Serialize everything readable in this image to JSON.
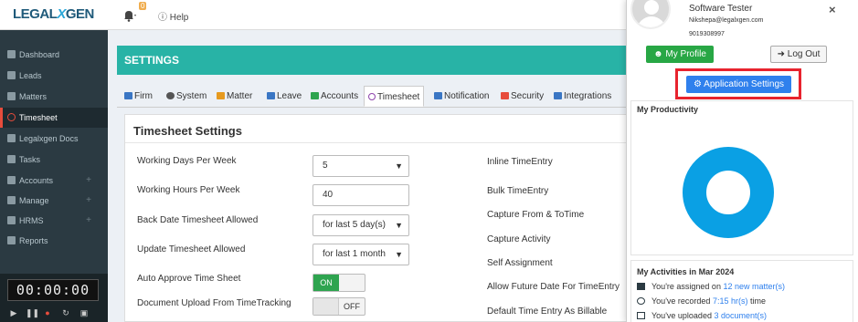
{
  "header": {
    "logo_main": "LEGAL",
    "logo_x": "X",
    "logo_end": "GEN",
    "notifications_count": "0",
    "help_label": "Help"
  },
  "sidebar": {
    "items": [
      {
        "label": "Dashboard",
        "icon": "dashboard-icon"
      },
      {
        "label": "Leads",
        "icon": "phone-icon"
      },
      {
        "label": "Matters",
        "icon": "briefcase-icon"
      },
      {
        "label": "Timesheet",
        "icon": "clock-icon"
      },
      {
        "label": "Legalxgen Docs",
        "icon": "folder-icon"
      },
      {
        "label": "Tasks",
        "icon": "tasks-icon"
      },
      {
        "label": "Accounts",
        "icon": "accounts-icon"
      },
      {
        "label": "Manage",
        "icon": "manage-icon"
      },
      {
        "label": "HRMS",
        "icon": "hrms-icon"
      },
      {
        "label": "Reports",
        "icon": "reports-icon"
      }
    ],
    "plus": "+",
    "timer": "00:00:00"
  },
  "settings": {
    "title": "SETTINGS",
    "tabs": [
      "Firm",
      "System",
      "Matter",
      "Leave",
      "Accounts",
      "Timesheet",
      "Notification",
      "Security",
      "Integrations"
    ],
    "active_tab": "Timesheet",
    "panel_title": "Timesheet Settings",
    "left_fields": [
      {
        "label": "Working Days Per Week",
        "value": "5"
      },
      {
        "label": "Working Hours Per Week",
        "value": "40"
      },
      {
        "label": "Back Date Timesheet Allowed",
        "value": "for last 5 day(s)"
      },
      {
        "label": "Update Timesheet Allowed",
        "value": "for last 1 month"
      },
      {
        "label": "Auto Approve Time Sheet",
        "value": "ON"
      },
      {
        "label": "Document Upload From TimeTracking",
        "value": "OFF"
      }
    ],
    "right_labels": [
      "Inline TimeEntry",
      "Bulk TimeEntry",
      "Capture From & ToTime",
      "Capture Activity",
      "Self Assignment",
      "Allow Future Date For TimeEntry",
      "Default Time Entry As Billable"
    ]
  },
  "profile": {
    "role": "Software Tester",
    "email": "Nikshepa@legalxgen.com",
    "phone": "9019308997",
    "close": "×",
    "my_profile_label": "My Profile",
    "logout_label": "Log Out",
    "app_settings_label": "Application Settings",
    "productivity_title": "My Productivity",
    "activities_title": "My Activities in Mar 2024",
    "activities": [
      {
        "prefix": "You're assigned on ",
        "link": "12 new matter(s)",
        "suffix": ""
      },
      {
        "prefix": "You've recorded ",
        "link": "7:15 hr(s)",
        "suffix": " time"
      },
      {
        "prefix": "You've uploaded ",
        "link": "3 document(s)",
        "suffix": ""
      }
    ],
    "donut_color": "#0aa0e4",
    "highlight_color": "#e8232e"
  }
}
